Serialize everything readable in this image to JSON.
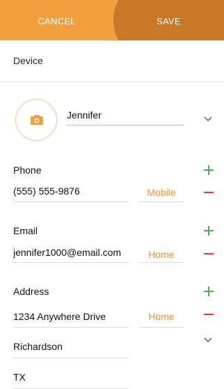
{
  "topbar": {
    "cancel_label": "CANCEL",
    "save_label": "SAVE"
  },
  "device": {
    "label": "Device"
  },
  "name": {
    "value": "Jennifer",
    "icon": "camera-icon"
  },
  "phone": {
    "label": "Phone",
    "value": "(555) 555-9876",
    "type": "Mobile"
  },
  "email": {
    "label": "Email",
    "value": "jennifer1000@email.com",
    "type": "Home"
  },
  "address": {
    "label": "Address",
    "street": "1234 Anywhere Drive",
    "type": "Home",
    "city": "Richardson",
    "state": "TX"
  },
  "colors": {
    "accent": "#f0a03c",
    "save_bg": "#c9782a",
    "add": "#4caf50",
    "remove": "#e53935",
    "type_text": "#e8902e"
  }
}
